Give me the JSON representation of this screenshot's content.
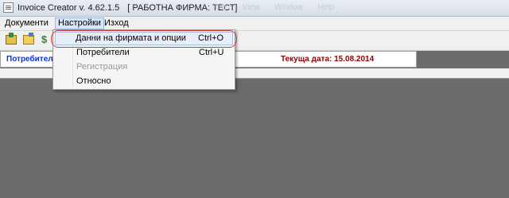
{
  "window": {
    "title": "Invoice Creator v. 4.62.1.5",
    "company": "[ РАБОТНА ФИРМА: ТЕСТ]",
    "background_menu_ghost": [
      "File",
      "View",
      "Window",
      "Help"
    ]
  },
  "menubar": {
    "items": [
      {
        "label": "Документи"
      },
      {
        "label": "Настройки"
      },
      {
        "label": "Изход"
      }
    ]
  },
  "toolbar": {
    "icons": [
      "open-document-icon",
      "folder-icon",
      "dollar-icon"
    ],
    "dollar_glyph": "$"
  },
  "infobar": {
    "users_label": "Потребители",
    "date_label": "Текуща дата: 15.08.2014"
  },
  "dropdown": {
    "items": [
      {
        "label": "Данни на фирмата и опции",
        "shortcut": "Ctrl+O",
        "enabled": true
      },
      {
        "label": "Потребители",
        "shortcut": "Ctrl+U",
        "enabled": true
      },
      {
        "label": "Регистрация",
        "shortcut": "",
        "enabled": false
      },
      {
        "label": "Относно",
        "shortcut": "",
        "enabled": true
      }
    ]
  },
  "colors": {
    "workspace": "#6b6b6b",
    "users_label": "#1030d0",
    "date_label": "#8b0000",
    "highlight_ring": "#d23a3a"
  }
}
